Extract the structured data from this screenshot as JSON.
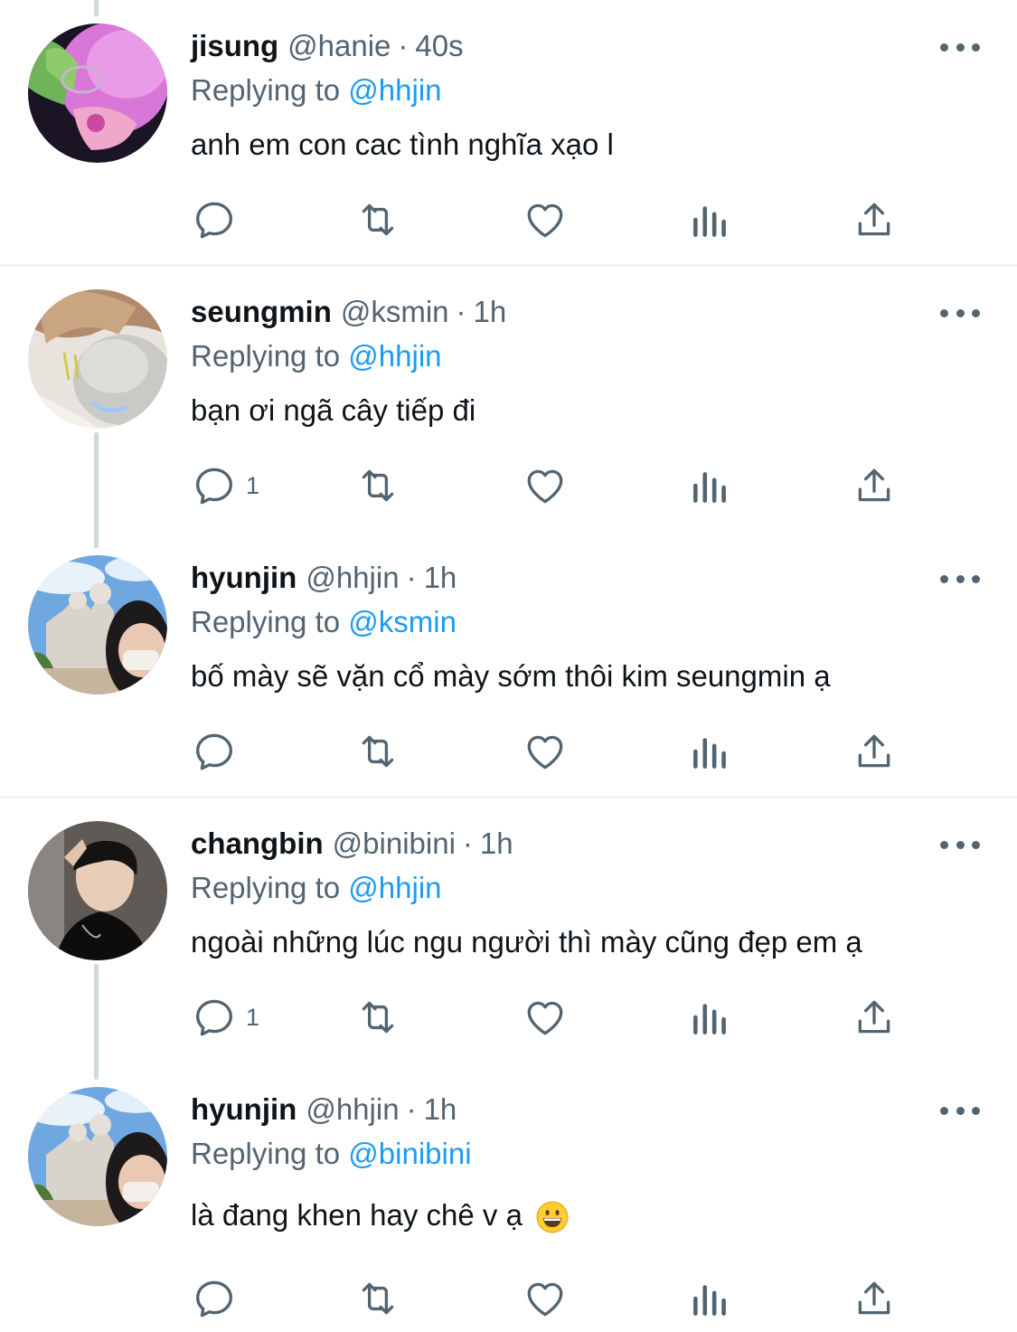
{
  "tweets": [
    {
      "name": "jisung",
      "handle": "@hanie",
      "separator": "·",
      "time": "40s",
      "replying_prefix": "Replying to",
      "replying_to": "@hhjin",
      "text": "anh em con cac tình nghĩa xạo l",
      "reply_count": ""
    },
    {
      "name": "seungmin",
      "handle": "@ksmin",
      "separator": "·",
      "time": "1h",
      "replying_prefix": "Replying to",
      "replying_to": "@hhjin",
      "text": "bạn ơi ngã cây tiếp đi",
      "reply_count": "1"
    },
    {
      "name": "hyunjin",
      "handle": "@hhjin",
      "separator": "·",
      "time": "1h",
      "replying_prefix": "Replying to",
      "replying_to": "@ksmin",
      "text": "bố mày sẽ vặn cổ mày sớm thôi kim seungmin ạ",
      "reply_count": ""
    },
    {
      "name": "changbin",
      "handle": "@binibini",
      "separator": "·",
      "time": "1h",
      "replying_prefix": "Replying to",
      "replying_to": "@hhjin",
      "text": "ngoài những lúc ngu người thì mày cũng đẹp em ạ",
      "reply_count": "1"
    },
    {
      "name": "hyunjin",
      "handle": "@hhjin",
      "separator": "·",
      "time": "1h",
      "replying_prefix": "Replying to",
      "replying_to": "@binibini",
      "text": "là đang khen hay chê v ạ",
      "reply_count": ""
    }
  ],
  "icons": {
    "reply": "reply-icon",
    "retweet": "retweet-icon",
    "like": "heart-icon",
    "views": "analytics-icon",
    "share": "share-icon",
    "more": "more-icon",
    "emoji": "grinning-face-emoji"
  },
  "colors": {
    "link": "#1d9bf0",
    "secondary_text": "#536471",
    "icon": "#536471",
    "thread_line": "#cfd9de",
    "divider": "#eff3f4"
  }
}
